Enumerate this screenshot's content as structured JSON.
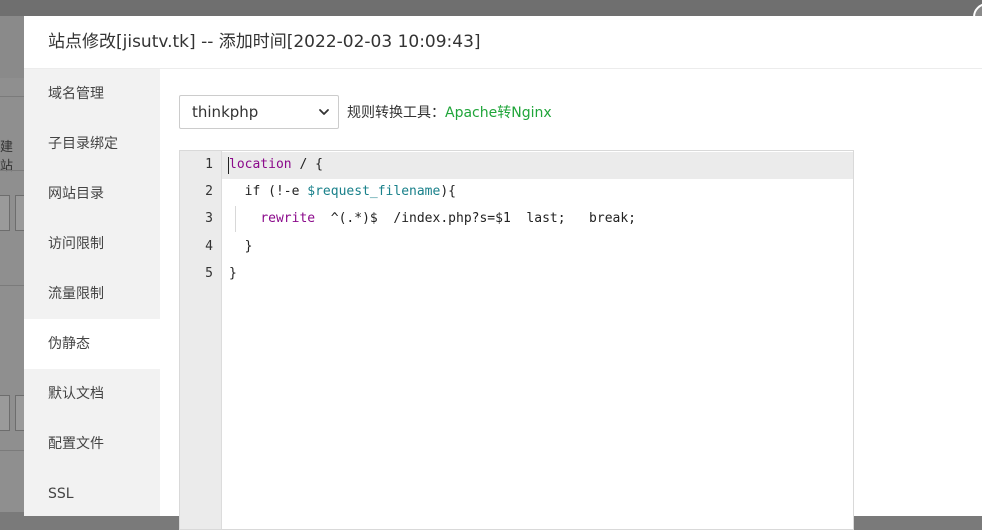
{
  "modal": {
    "title": "站点修改[jisutv.tk] -- 添加时间[2022-02-03 10:09:43]"
  },
  "background": {
    "fragment_text": "建站"
  },
  "sidebar": {
    "items": [
      {
        "label": "域名管理"
      },
      {
        "label": "子目录绑定"
      },
      {
        "label": "网站目录"
      },
      {
        "label": "访问限制"
      },
      {
        "label": "流量限制"
      },
      {
        "label": "伪静态",
        "active": true
      },
      {
        "label": "默认文档"
      },
      {
        "label": "配置文件"
      },
      {
        "label": "SSL"
      }
    ]
  },
  "toolbar": {
    "template_select_value": "thinkphp",
    "converter_label": "规则转换工具：",
    "converter_link": "Apache转Nginx"
  },
  "editor": {
    "line_numbers": [
      "1",
      "2",
      "3",
      "4",
      "5"
    ],
    "lines": [
      {
        "kw": "location",
        "rest": " / {"
      },
      {
        "pre": "  if (!-e ",
        "var": "$request_filename",
        "post": "){"
      },
      {
        "pre": "    ",
        "kw": "rewrite",
        "post": "  ^(.*)$  /index.php?s=$1  last;   break;"
      },
      {
        "text": "  }"
      },
      {
        "text": "}"
      }
    ]
  },
  "colors": {
    "accent_green": "#20a53a",
    "keyword_purple": "#8b0a8b",
    "variable_teal": "#19808a",
    "sidebar_bg": "#f2f2f2"
  }
}
